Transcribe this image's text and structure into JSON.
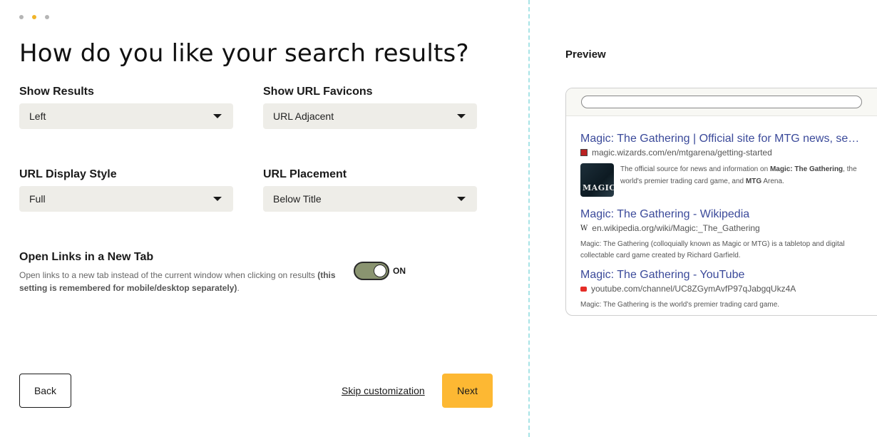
{
  "wizard": {
    "title": "How do you like your search results?",
    "fields": {
      "show_results": {
        "label": "Show Results",
        "value": "Left"
      },
      "show_url_favicons": {
        "label": "Show URL Favicons",
        "value": "URL Adjacent"
      },
      "url_display_style": {
        "label": "URL Display Style",
        "value": "Full"
      },
      "url_placement": {
        "label": "URL Placement",
        "value": "Below Title"
      }
    },
    "new_tab": {
      "title": "Open Links in a New Tab",
      "description": "Open links to a new tab instead of the current window when clicking on results",
      "description_bold": "(this setting is remembered for mobile/desktop separately)",
      "description_end": ".",
      "state": "ON"
    },
    "buttons": {
      "back": "Back",
      "skip": "Skip customization",
      "next": "Next"
    },
    "colors": {
      "accent": "#fdb833",
      "toggle_on": "#8a9470",
      "link": "#3b4a9a",
      "divider": "#a8e4e6"
    }
  },
  "preview": {
    "label": "Preview",
    "results": [
      {
        "title": "Magic: The Gathering | Official site for MTG news, sets, and events",
        "favicon": "mtg-favicon",
        "url": "magic.wizards.com/en/mtgarena/getting-started",
        "thumb_text": "MAGIC",
        "snippet_a": "The official source for news and information on ",
        "snippet_b": "Magic: The Gathering",
        "snippet_c": ", the world's premier trading card game, and ",
        "snippet_d": "MTG",
        "snippet_e": " Arena."
      },
      {
        "title": "Magic: The Gathering - Wikipedia",
        "favicon": "wikipedia-favicon",
        "favicon_glyph": "W",
        "url": "en.wikipedia.org/wiki/Magic:_The_Gathering",
        "snippet": "Magic: The Gathering (colloquially known as Magic or MTG) is a tabletop and digital collectable card game created by Richard Garfield."
      },
      {
        "title": "Magic: The Gathering - YouTube",
        "favicon": "youtube-favicon",
        "url": "youtube.com/channel/UC8ZGymAvfP97qJabgqUkz4A",
        "snippet": "Magic: The Gathering is the world's premier trading card game."
      }
    ]
  }
}
